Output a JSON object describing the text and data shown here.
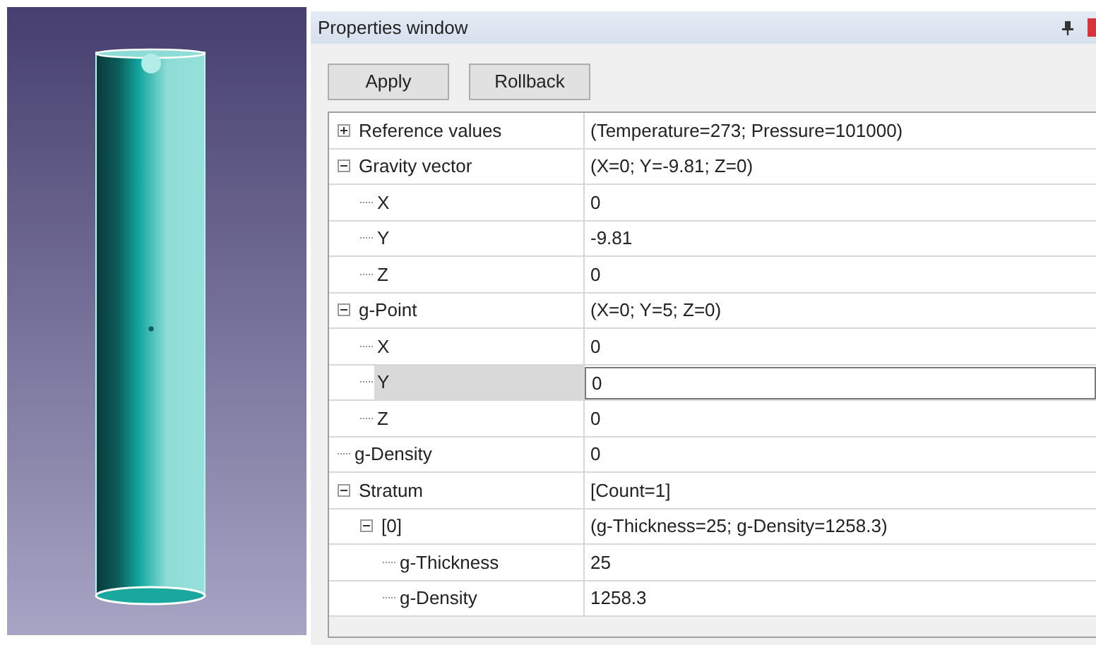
{
  "viewport": {
    "kind": "picture"
  },
  "panel": {
    "title": "Properties window"
  },
  "buttons": [
    "Apply",
    "Rollback"
  ],
  "properties": [
    {
      "name": "Reference values",
      "value": "(Temperature=273; Pressure=101000)",
      "expanded": false,
      "selected": false
    },
    {
      "name": "Gravity vector",
      "value": "(X=0; Y=-9.81; Z=0)",
      "expanded": true,
      "selected": false,
      "children": [
        {
          "name": "X",
          "value": "0",
          "selected": false
        },
        {
          "name": "Y",
          "value": "-9.81",
          "selected": false
        },
        {
          "name": "Z",
          "value": "0",
          "selected": false
        }
      ]
    },
    {
      "name": "g-Point",
      "value": "(X=0; Y=5; Z=0)",
      "expanded": true,
      "selected": false,
      "children": [
        {
          "name": "X",
          "value": "0",
          "selected": false
        },
        {
          "name": "Y",
          "value": "0",
          "selected": true
        },
        {
          "name": "Z",
          "value": "0",
          "selected": false
        }
      ]
    },
    {
      "name": "g-Density",
      "value": "0",
      "selected": false
    },
    {
      "name": "Stratum",
      "value": "[Count=1]",
      "expanded": true,
      "selected": false,
      "children": [
        {
          "name": "[0]",
          "value": "(g-Thickness=25; g-Density=1258.3)",
          "expanded": true,
          "selected": false,
          "children": [
            {
              "name": "g-Thickness",
              "value": "25",
              "selected": false
            },
            {
              "name": "g-Density",
              "value": "1258.3",
              "selected": false
            }
          ]
        }
      ]
    }
  ]
}
